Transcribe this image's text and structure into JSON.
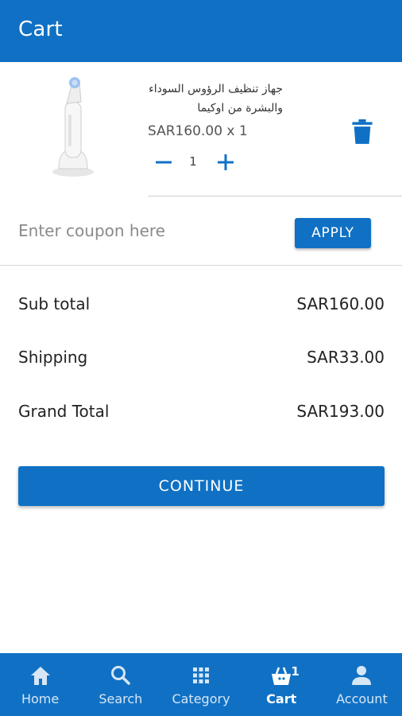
{
  "appbar": {
    "title": "Cart"
  },
  "cart_item": {
    "name": "جهاز تنظيف الرؤوس السوداء والبشرة من اوكيما",
    "price_line": "SAR160.00 x 1",
    "quantity": "1"
  },
  "coupon": {
    "placeholder": "Enter coupon here",
    "apply_label": "APPLY"
  },
  "totals": {
    "subtotal_label": "Sub total",
    "subtotal_value": "SAR160.00",
    "shipping_label": "Shipping",
    "shipping_value": "SAR33.00",
    "grand_label": "Grand Total",
    "grand_value": "SAR193.00"
  },
  "continue_label": "CONTINUE",
  "nav": {
    "items": [
      {
        "label": "Home",
        "icon": "home-icon"
      },
      {
        "label": "Search",
        "icon": "search-icon"
      },
      {
        "label": "Category",
        "icon": "grid-icon"
      },
      {
        "label": "Cart",
        "icon": "cart-icon",
        "badge": "1"
      },
      {
        "label": "Account",
        "icon": "account-icon"
      }
    ]
  },
  "colors": {
    "primary": "#1071c4",
    "background": "#ffffff"
  }
}
